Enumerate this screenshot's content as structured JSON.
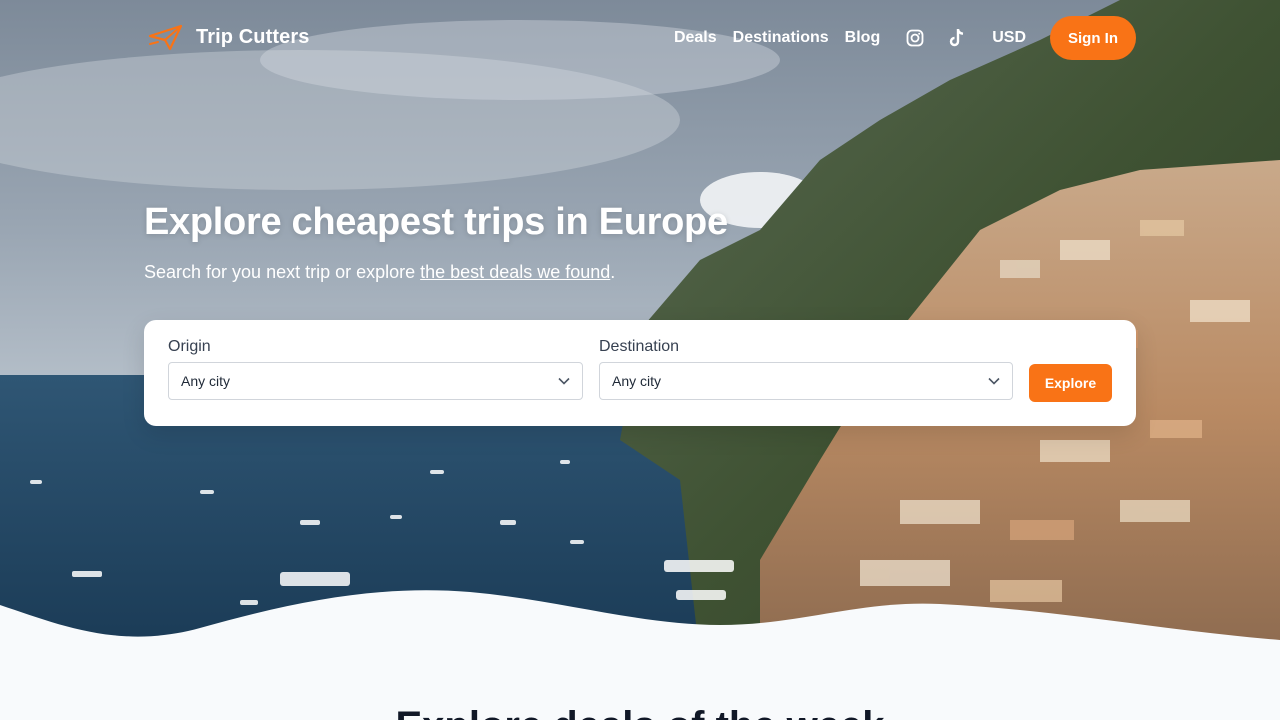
{
  "brand": {
    "name": "Trip Cutters",
    "logo_icon": "paper-plane-icon",
    "accent": "#f97316"
  },
  "nav": {
    "links": [
      "Deals",
      "Destinations",
      "Blog"
    ],
    "instagram_icon": "instagram-icon",
    "tiktok_icon": "tiktok-icon",
    "currency": "USD",
    "signin_label": "Sign In"
  },
  "hero": {
    "title": "Explore cheapest trips in Europe",
    "subtitle_prefix": "Search for you next trip or explore ",
    "subtitle_link": "the best deals we found",
    "subtitle_suffix": "."
  },
  "search": {
    "origin_label": "Origin",
    "origin_value": "Any city",
    "destination_label": "Destination",
    "destination_value": "Any city",
    "explore_label": "Explore"
  },
  "section": {
    "title": "Explore deals of the week"
  }
}
